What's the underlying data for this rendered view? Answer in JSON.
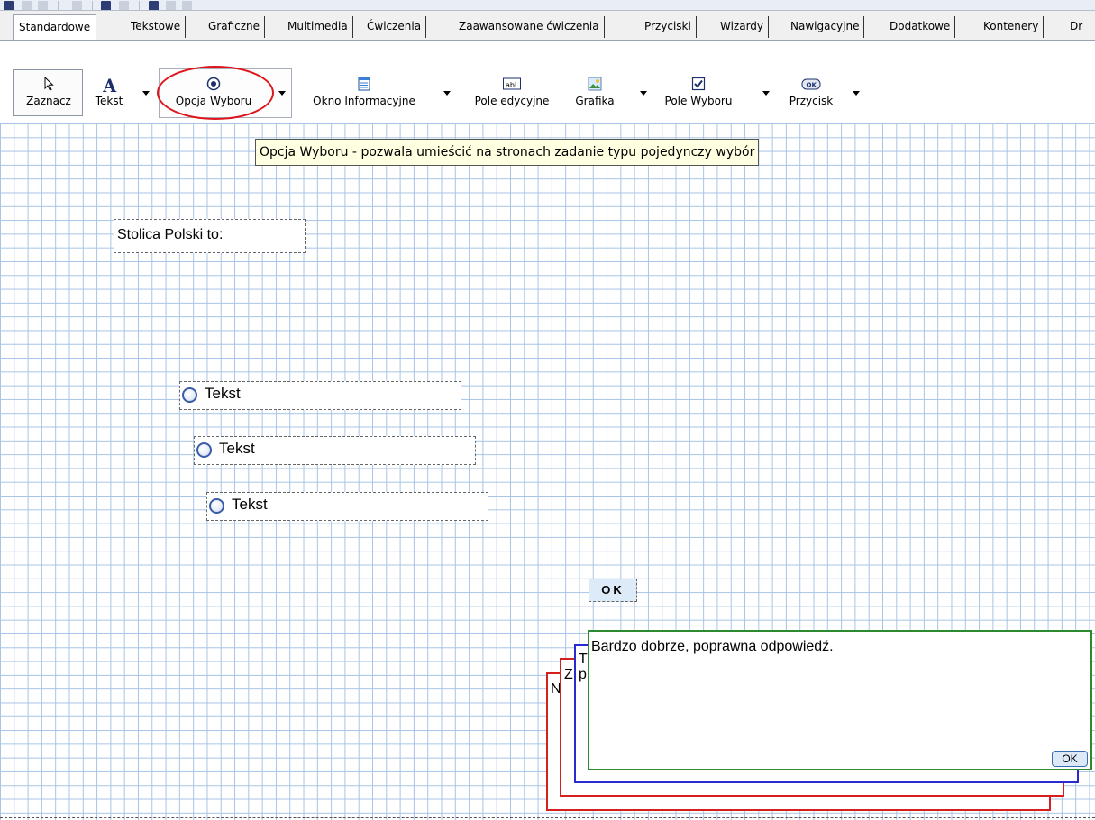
{
  "tabs": [
    {
      "label": "Standardowe",
      "active": true
    },
    {
      "label": "Tekstowe"
    },
    {
      "label": "Graficzne"
    },
    {
      "label": "Multimedia"
    },
    {
      "label": "Ćwiczenia"
    },
    {
      "label": "Zaawansowane ćwiczenia"
    },
    {
      "label": "Przyciski"
    },
    {
      "label": "Wizardy"
    },
    {
      "label": "Nawigacyjne"
    },
    {
      "label": "Dodatkowe"
    },
    {
      "label": "Kontenery"
    },
    {
      "label": "Dr"
    }
  ],
  "toolbar": {
    "select": "Zaznacz",
    "text": "Tekst",
    "radio": "Opcja Wyboru",
    "info_window": "Okno Informacyjne",
    "edit_field": "Pole edycyjne",
    "graphic": "Grafika",
    "checkbox": "Pole Wyboru",
    "button": "Przycisk",
    "edit_icon_text": "abl",
    "button_icon_text": "OK",
    "highlight_color": "#e0141b"
  },
  "tooltip": "Opcja Wyboru - pozwala umieścić na stronach zadanie typu pojedynczy wybór",
  "canvas": {
    "question": "Stolica Polski to:",
    "options": [
      {
        "label": "Tekst"
      },
      {
        "label": "Tekst"
      },
      {
        "label": "Tekst"
      }
    ],
    "ok_button": "OK",
    "feedback_windows": [
      {
        "text": "N",
        "border_color": "#d62020"
      },
      {
        "text": "Z",
        "border_color": "#d62020"
      },
      {
        "text": "T\np",
        "border_color": "#2a2ad0"
      },
      {
        "text": "Bardzo dobrze, poprawna odpowiedź.",
        "border_color": "#2e8a2e",
        "ok_label": "OK"
      }
    ]
  }
}
